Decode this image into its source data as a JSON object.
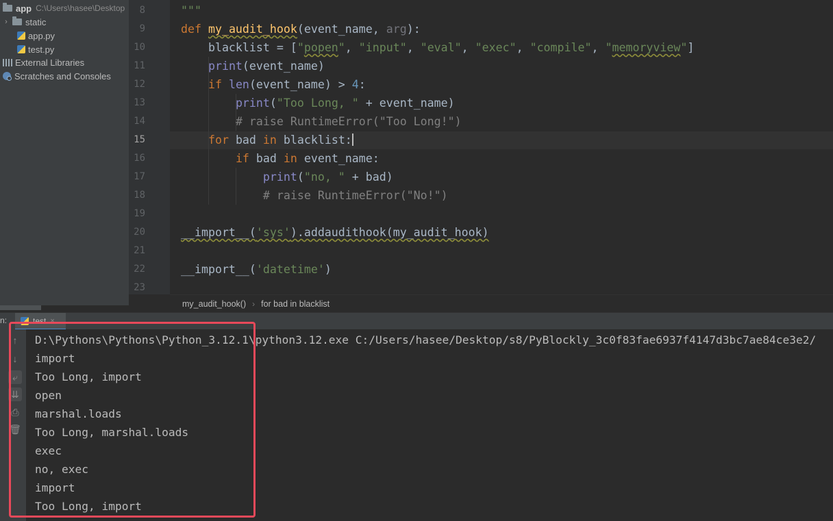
{
  "project": {
    "root_name": "app",
    "root_path": "C:\\Users\\hasee\\Desktop",
    "items": [
      {
        "label": "static",
        "icon": "folder-icon"
      },
      {
        "label": "app.py",
        "icon": "python-file-icon"
      },
      {
        "label": "test.py",
        "icon": "python-file-icon"
      },
      {
        "label": "External Libraries",
        "icon": "library-icon"
      },
      {
        "label": "Scratches and Consoles",
        "icon": "scratches-icon"
      }
    ]
  },
  "editor": {
    "line_numbers": [
      "8",
      "9",
      "10",
      "11",
      "12",
      "13",
      "14",
      "15",
      "16",
      "17",
      "18",
      "19",
      "20",
      "21",
      "22",
      "23"
    ],
    "current_line": "15"
  },
  "breadcrumb": {
    "items": [
      "my_audit_hook()",
      "for bad in blacklist"
    ]
  },
  "run": {
    "prefix": "n:",
    "tab_label": "test",
    "tab_close": "×"
  },
  "console": {
    "lines": [
      "D:\\Pythons\\Pythons\\Python_3.12.1\\python3.12.exe C:/Users/hasee/Desktop/s8/PyBlockly_3c0f83fae6937f4147d3bc7ae84ce3e2/",
      "import",
      "Too Long, import",
      "open",
      "marshal.loads",
      "Too Long, marshal.loads",
      "exec",
      "no, exec",
      "import",
      "Too Long, import"
    ]
  },
  "colors": {
    "highlight_box": "#e8495a",
    "keyword": "#cc7832",
    "string": "#6a8759",
    "function_name": "#ffc66d",
    "builtin": "#8888c6"
  }
}
